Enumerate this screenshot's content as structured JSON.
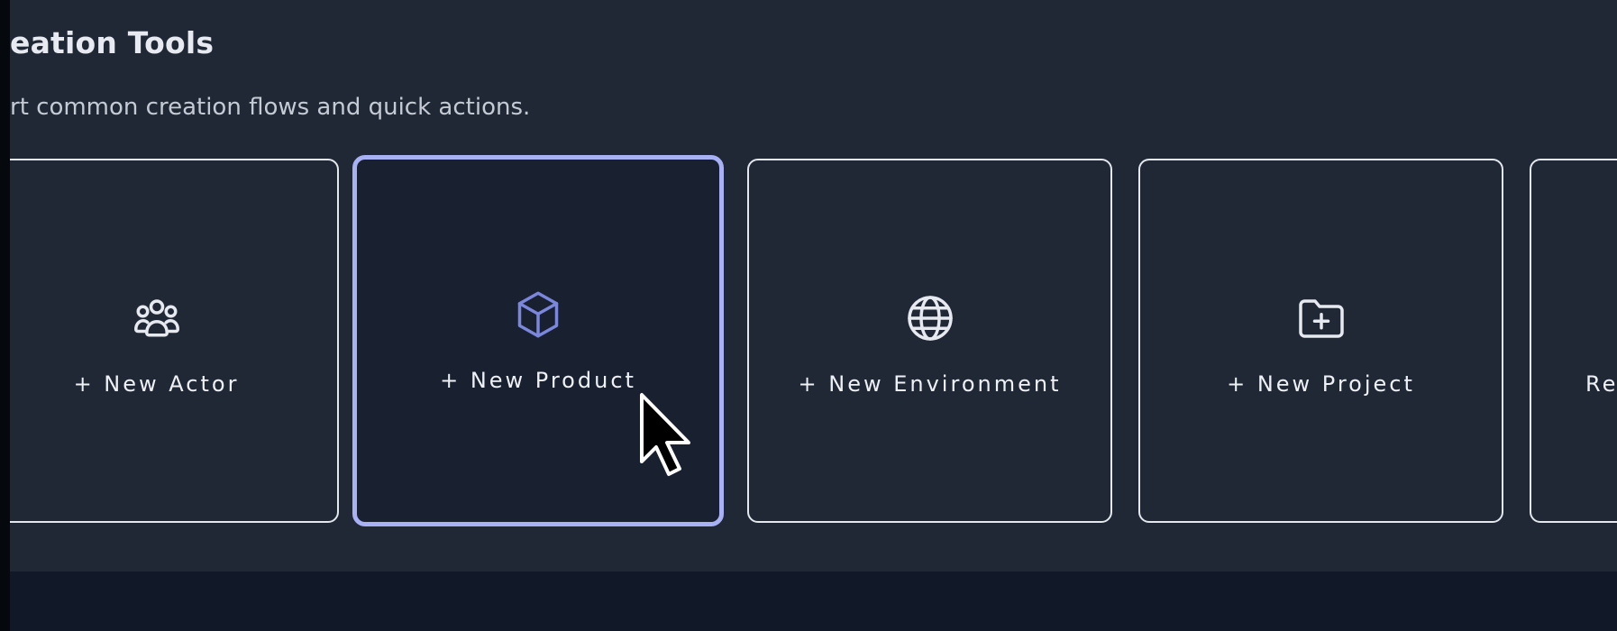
{
  "section": {
    "title": "eation Tools",
    "subtitle": "rt common creation flows and quick actions."
  },
  "cards": [
    {
      "label": "+ New Actor",
      "icon": "users-icon",
      "state": "default"
    },
    {
      "label": "+ New Product",
      "icon": "cube-icon",
      "state": "hovered"
    },
    {
      "label": "+ New Environment",
      "icon": "globe-icon",
      "state": "default"
    },
    {
      "label": "+ New Project",
      "icon": "folder-plus-icon",
      "state": "default"
    },
    {
      "label": "Re",
      "icon": "",
      "state": "default"
    }
  ],
  "colors": {
    "panel_background": "#202836",
    "footer_background": "#111827",
    "card_border": "#e3e7ee",
    "active_border": "#a7b1f3",
    "active_icon": "#7b87dc",
    "icon_default": "#e6e9ef",
    "text_primary": "#e7ebf1",
    "text_secondary": "#c5cbd5"
  },
  "pointer": {
    "icon": "mouse-pointer-icon"
  }
}
